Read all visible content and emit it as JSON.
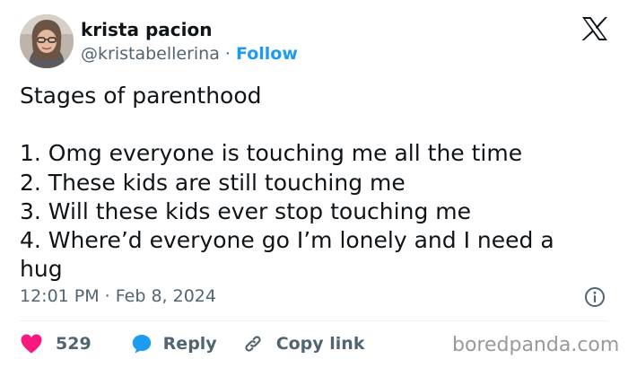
{
  "author": {
    "display_name": "krista pacion",
    "handle": "@kristabellerina",
    "separator": " · ",
    "follow_label": "Follow"
  },
  "tweet": {
    "heading": "Stages of parenthood",
    "lines": [
      "1. Omg everyone is touching me all the time",
      "2. These kids are still touching me",
      "3. Will these kids ever stop touching me",
      "4. Where’d everyone go I’m lonely and I need a",
      "hug"
    ],
    "timestamp": "12:01 PM · Feb 8, 2024"
  },
  "actions": {
    "like_count": "529",
    "reply_label": "Reply",
    "copy_link_label": "Copy link"
  },
  "icons": {
    "platform_logo": "x-logo-icon",
    "info": "info-icon",
    "like": "heart-icon",
    "reply": "speech-bubble-icon",
    "copy_link": "link-icon"
  },
  "colors": {
    "text_primary": "#0f1419",
    "text_secondary": "#536471",
    "accent_blue": "#1d9bf0",
    "like_pink": "#f91880",
    "divider": "#eff3f4"
  },
  "watermark": "boredpanda.com"
}
